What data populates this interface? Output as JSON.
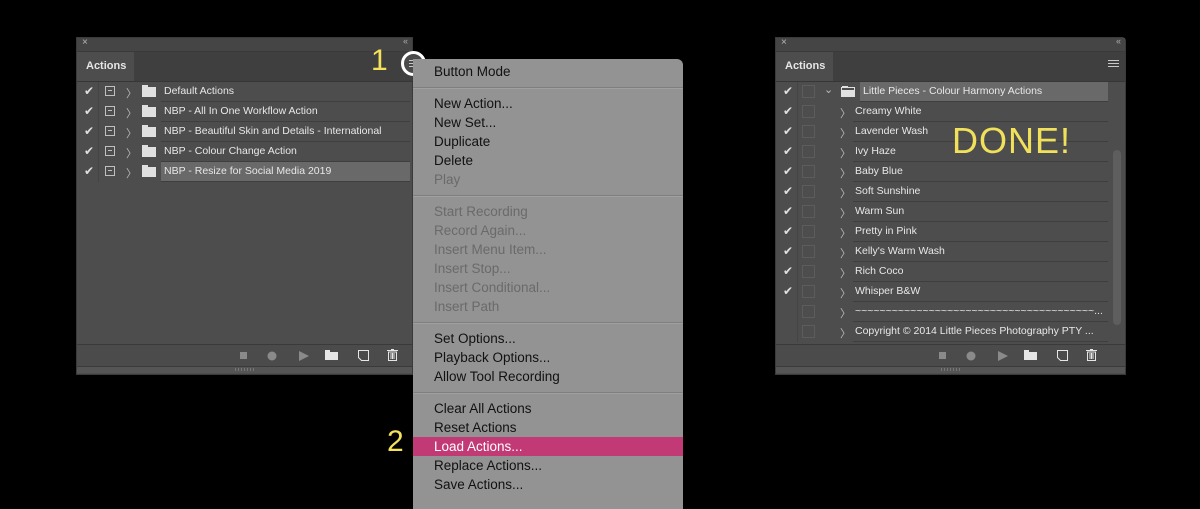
{
  "left_panel": {
    "close_label": "×",
    "collapse_label": "‹‹",
    "tab_label": "Actions",
    "rows": [
      {
        "checked": true,
        "name": "Default Actions"
      },
      {
        "checked": true,
        "name": "NBP - All In One Workflow Action"
      },
      {
        "checked": true,
        "name": "NBP - Beautiful Skin and Details  - International"
      },
      {
        "checked": true,
        "name": "NBP - Colour Change Action"
      },
      {
        "checked": true,
        "name": "NBP - Resize for Social Media 2019",
        "selected": true
      }
    ],
    "footer_icons": [
      "stop-icon",
      "record-icon",
      "play-icon",
      "new-set-icon",
      "new-action-icon",
      "delete-icon"
    ]
  },
  "step_labels": {
    "one": "1",
    "two": "2"
  },
  "dropdown_menu": {
    "groups": [
      [
        {
          "label": "Button Mode",
          "enabled": true
        }
      ],
      [
        {
          "label": "New Action...",
          "enabled": true
        },
        {
          "label": "New Set...",
          "enabled": true
        },
        {
          "label": "Duplicate",
          "enabled": true
        },
        {
          "label": "Delete",
          "enabled": true
        },
        {
          "label": "Play",
          "enabled": false
        }
      ],
      [
        {
          "label": "Start Recording",
          "enabled": false
        },
        {
          "label": "Record Again...",
          "enabled": false
        },
        {
          "label": "Insert Menu Item...",
          "enabled": false
        },
        {
          "label": "Insert Stop...",
          "enabled": false
        },
        {
          "label": "Insert Conditional...",
          "enabled": false
        },
        {
          "label": "Insert Path",
          "enabled": false
        }
      ],
      [
        {
          "label": "Set Options...",
          "enabled": true
        },
        {
          "label": "Playback Options...",
          "enabled": true
        },
        {
          "label": "Allow Tool Recording",
          "enabled": true
        }
      ],
      [
        {
          "label": "Clear All Actions",
          "enabled": true
        },
        {
          "label": "Reset Actions",
          "enabled": true
        },
        {
          "label": "Load Actions...",
          "enabled": true,
          "highlighted": true
        },
        {
          "label": "Replace Actions...",
          "enabled": true
        },
        {
          "label": "Save Actions...",
          "enabled": true
        }
      ]
    ],
    "highlight_color": "#c23a75"
  },
  "right_panel": {
    "close_label": "×",
    "collapse_label": "‹‹",
    "tab_label": "Actions",
    "set_name": "Little Pieces - Colour Harmony Actions",
    "actions": [
      {
        "checked": true,
        "name": "Creamy White"
      },
      {
        "checked": true,
        "name": "Lavender Wash"
      },
      {
        "checked": true,
        "name": "Ivy Haze"
      },
      {
        "checked": true,
        "name": "Baby Blue"
      },
      {
        "checked": true,
        "name": "Soft Sunshine"
      },
      {
        "checked": true,
        "name": "Warm Sun"
      },
      {
        "checked": true,
        "name": "Pretty in Pink"
      },
      {
        "checked": true,
        "name": "Kelly's Warm Wash"
      },
      {
        "checked": true,
        "name": "Rich Coco"
      },
      {
        "checked": true,
        "name": "Whisper B&W"
      },
      {
        "checked": false,
        "name": "~~~~~~~~~~~~~~~~~~~~~~~~~~~~~~~~~~~~~~~..."
      },
      {
        "checked": false,
        "name": "Copyright © 2014 Little Pieces Photography PTY ..."
      }
    ],
    "done_label": "DONE!"
  }
}
